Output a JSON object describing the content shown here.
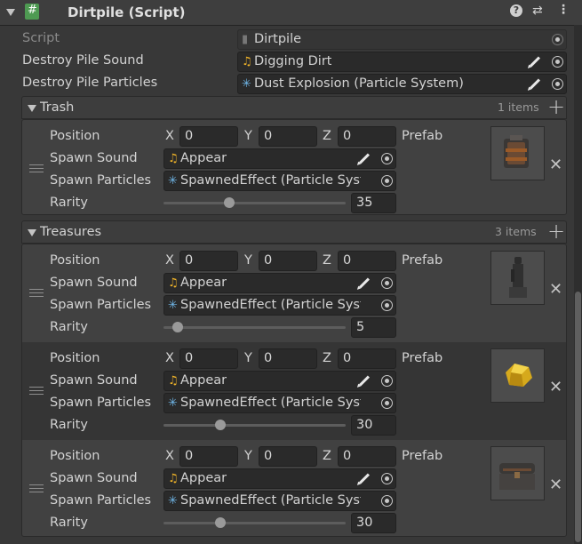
{
  "header": {
    "title": "Dirtpile (Script)",
    "help_icon": "help-icon",
    "settings_icon": "presets-icon",
    "menu_icon": "kebab-menu-icon"
  },
  "fields": {
    "script_label": "Script",
    "script_value": "Dirtpile",
    "destroy_sound_label": "Destroy Pile Sound",
    "destroy_sound_value": "Digging Dirt",
    "destroy_particles_label": "Destroy Pile Particles",
    "destroy_particles_value": "Dust Explosion (Particle System)"
  },
  "trash": {
    "title": "Trash",
    "count": "1 items",
    "elements": [
      {
        "position_label": "Position",
        "x_label": "X",
        "x": "0",
        "y_label": "Y",
        "y": "0",
        "z_label": "Z",
        "z": "0",
        "prefab_label": "Prefab",
        "prefab_preview": "barrel-prefab",
        "sound_label": "Spawn Sound",
        "sound": "Appear",
        "particles_label": "Spawn Particles",
        "particles": "SpawnedEffect (Particle System)",
        "rarity_label": "Rarity",
        "rarity": "35"
      }
    ]
  },
  "treasures": {
    "title": "Treasures",
    "count": "3 items",
    "elements": [
      {
        "position_label": "Position",
        "x_label": "X",
        "x": "0",
        "y_label": "Y",
        "y": "0",
        "z_label": "Z",
        "z": "0",
        "prefab_label": "Prefab",
        "prefab_preview": "statue-prefab",
        "sound_label": "Spawn Sound",
        "sound": "Appear",
        "particles_label": "Spawn Particles",
        "particles": "SpawnedEffect (Particle System)",
        "rarity_label": "Rarity",
        "rarity": "5"
      },
      {
        "position_label": "Position",
        "x_label": "X",
        "x": "0",
        "y_label": "Y",
        "y": "0",
        "z_label": "Z",
        "z": "0",
        "prefab_label": "Prefab",
        "prefab_preview": "gold-gem-prefab",
        "sound_label": "Spawn Sound",
        "sound": "Appear",
        "particles_label": "Spawn Particles",
        "particles": "SpawnedEffect (Particle System)",
        "rarity_label": "Rarity",
        "rarity": "30"
      },
      {
        "position_label": "Position",
        "x_label": "X",
        "x": "0",
        "y_label": "Y",
        "y": "0",
        "z_label": "Z",
        "z": "0",
        "prefab_label": "Prefab",
        "prefab_preview": "chest-prefab",
        "sound_label": "Spawn Sound",
        "sound": "Appear",
        "particles_label": "Spawn Particles",
        "particles": "SpawnedEffect (Particle System)",
        "rarity_label": "Rarity",
        "rarity": "30"
      }
    ]
  },
  "rarity_slider": {
    "min": 0,
    "max": 100
  },
  "colors": {
    "background": "#383838",
    "field": "#2a2a2a",
    "audio_icon": "#f0b429",
    "particle_icon": "#6fb6e8"
  }
}
